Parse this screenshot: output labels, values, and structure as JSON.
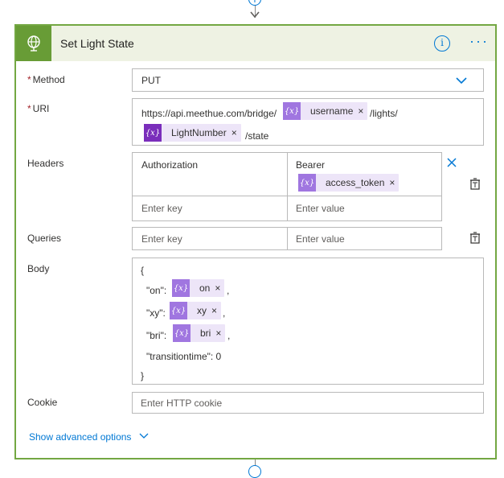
{
  "card": {
    "title": "Set Light State",
    "header_color": "#689c36",
    "border_color": "#73a742",
    "header_bg": "#eef2e3"
  },
  "method": {
    "label": "Method",
    "required": "*",
    "value": "PUT"
  },
  "uri": {
    "label": "URI",
    "required": "*",
    "prefix": "https://api.meethue.com/bridge/",
    "token_username": "username",
    "middle": "/lights/",
    "token_lightnumber": "LightNumber",
    "suffix": "/state"
  },
  "headers": {
    "label": "Headers",
    "key": "Authorization",
    "value_text": "Bearer",
    "token_access": "access_token",
    "key_placeholder": "Enter key",
    "value_placeholder": "Enter value"
  },
  "queries": {
    "label": "Queries",
    "key_placeholder": "Enter key",
    "value_placeholder": "Enter value"
  },
  "body": {
    "label": "Body",
    "open_brace": "{",
    "on_key": "\"on\":",
    "on_token": "on",
    "xy_key": "\"xy\":",
    "xy_token": "xy",
    "bri_key": "\"bri\":",
    "bri_token": "bri",
    "comma": ",",
    "transition_line": "\"transitiontime\": 0",
    "close_brace": "}"
  },
  "cookie": {
    "label": "Cookie",
    "placeholder": "Enter HTTP cookie"
  },
  "advanced": {
    "label": "Show advanced options"
  },
  "token_symbol": "{x}",
  "remove_symbol": "×",
  "accent_color": "#0078d4",
  "token_color": "#a076e0",
  "token_dark_color": "#7a2ebb"
}
